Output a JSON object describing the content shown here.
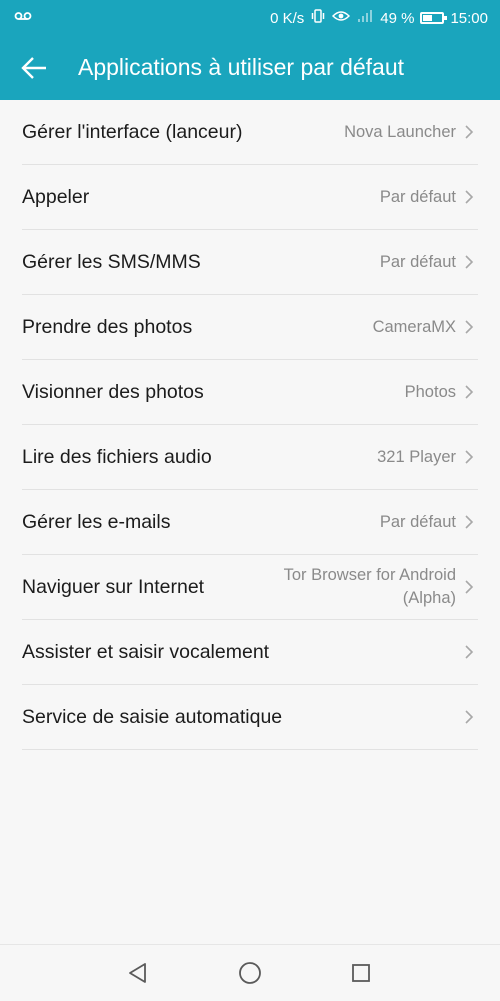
{
  "status_bar": {
    "voicemail_icon": "voicemail-icon",
    "speed": "0 K/s",
    "battery_percent": "49 %",
    "battery_level": 0.49,
    "time": "15:00"
  },
  "app_bar": {
    "title": "Applications à utiliser par défaut",
    "back_icon": "arrow-left-icon",
    "background_color": "#1aa5bd"
  },
  "items": [
    {
      "label": "Gérer l'interface (lanceur)",
      "value": "Nova Launcher"
    },
    {
      "label": "Appeler",
      "value": "Par défaut"
    },
    {
      "label": "Gérer les SMS/MMS",
      "value": "Par défaut"
    },
    {
      "label": "Prendre des photos",
      "value": "CameraMX"
    },
    {
      "label": "Visionner des photos",
      "value": "Photos"
    },
    {
      "label": "Lire des fichiers audio",
      "value": "321 Player"
    },
    {
      "label": "Gérer les e-mails",
      "value": "Par défaut"
    },
    {
      "label": "Naviguer sur Internet",
      "value_line1": "Tor Browser for Android",
      "value_line2": "(Alpha)"
    },
    {
      "label": "Assister et saisir vocalement",
      "value": ""
    },
    {
      "label": "Service de saisie automatique",
      "value": ""
    }
  ],
  "nav_bar": {
    "back_icon": "triangle-back-icon",
    "home_icon": "circle-home-icon",
    "recents_icon": "square-recents-icon"
  }
}
